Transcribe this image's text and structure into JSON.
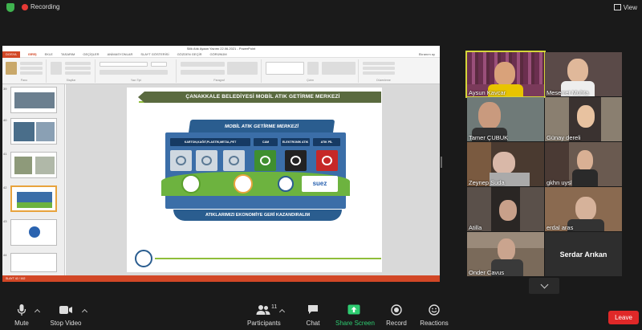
{
  "topbar": {
    "recording_label": "Recording",
    "view_label": "View"
  },
  "ppt": {
    "window_title": "Silik Atık Ayaan Yazımı 22.06.2021 - PowerPoint",
    "tabs": [
      "DOSYA",
      "GİRİŞ",
      "EKLE",
      "TASARIM",
      "GEÇİŞLER",
      "ANİMASYONLAR",
      "SLAYT GÖSTERİSİ",
      "GÖZDEN GEÇİR",
      "GÖRÜNÜM"
    ],
    "user": "Ekranım ay",
    "groups": [
      "Pano",
      "Slaytlar",
      "Yazı Tipi",
      "Paragraf",
      "Çizim",
      "Düzenleme"
    ],
    "thumb_numbers": [
      "39",
      "40",
      "41",
      "42",
      "43",
      "44"
    ],
    "status_text": "SLAYT 42 / 162"
  },
  "slide": {
    "header": "ÇANAKKALE BELEDİYESİ MOBİL ATIK GETİRME MERKEZİ",
    "bin_title": "MOBİL ATIK GETİRME MERKEZİ",
    "categories": [
      "KARTON,KAĞIT,PLASTİK,METAL,PET",
      "CAM",
      "ELEKTRONİK ATIK",
      "ATIK PİL"
    ],
    "partner_label": "suez",
    "slogan": "ATIKLARIMIZI EKONOMİYE GERİ KAZANDIRALIM"
  },
  "participants": [
    {
      "name": "Aysun Kavcar"
    },
    {
      "name": "Meserret Muhta"
    },
    {
      "name": "Tamer ÇUBUK"
    },
    {
      "name": "Günay dereli"
    },
    {
      "name": "Zeynep Suda"
    },
    {
      "name": "gkhn uysl"
    },
    {
      "name": "Atilla"
    },
    {
      "name": "erdal aras"
    },
    {
      "name": "Onder Cavus"
    },
    {
      "name": "Serdar Arıkan"
    }
  ],
  "toolbar": {
    "mute": "Mute",
    "stop_video": "Stop Video",
    "participants": "Participants",
    "participants_count": "11",
    "chat": "Chat",
    "share_screen": "Share Screen",
    "record": "Record",
    "reactions": "Reactions",
    "leave": "Leave"
  },
  "colors": {
    "share_green": "#2ecc71",
    "leave_red": "#e02828",
    "ppt_orange": "#d24726",
    "active_speaker": "#d5d53a"
  }
}
